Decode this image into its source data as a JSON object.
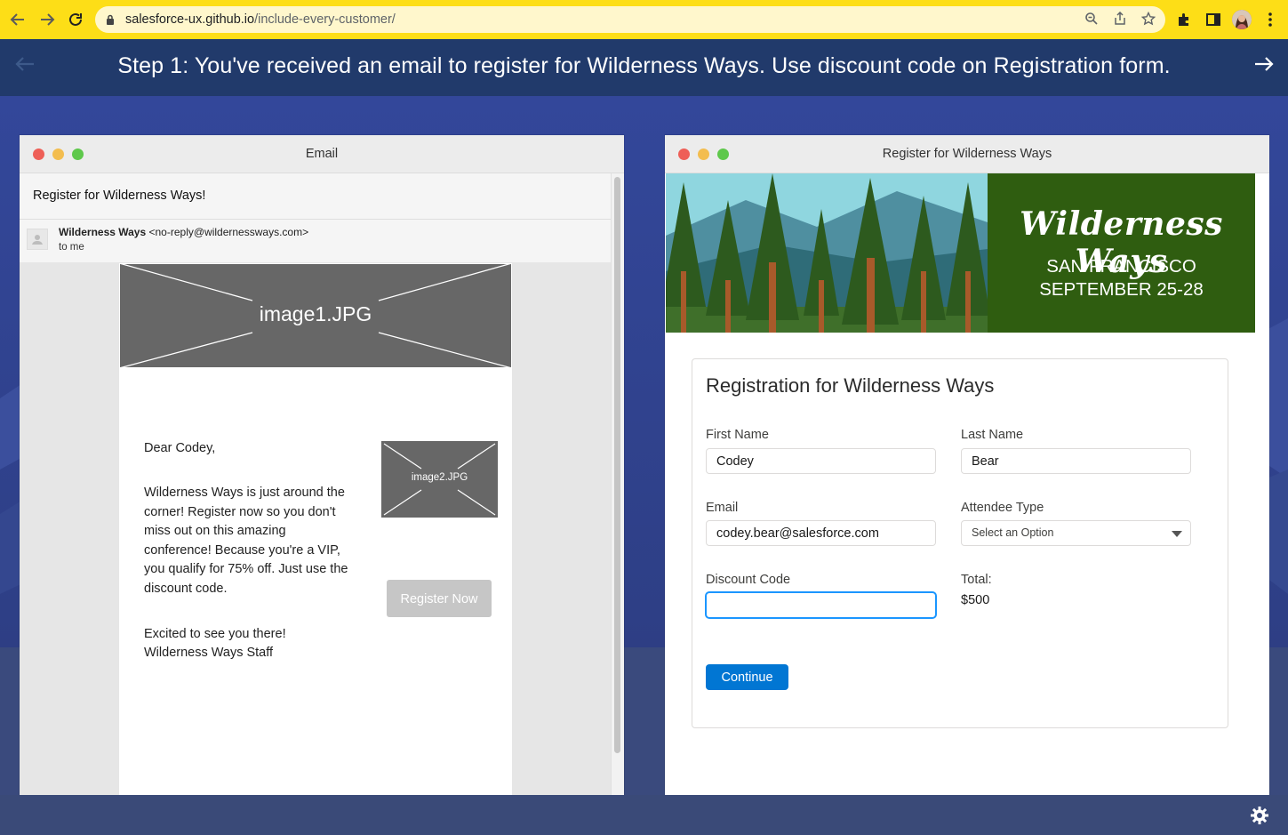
{
  "browser": {
    "url_host": "salesforce-ux.github.io",
    "url_path": "/include-every-customer/"
  },
  "step": {
    "text": "Step 1: You've received an email to register for Wilderness Ways. Use discount code on Registration form."
  },
  "email_window": {
    "title": "Email",
    "subject": "Register for Wilderness Ways!",
    "sender_name": "Wilderness Ways",
    "sender_email": "<no-reply@wildernessways.com>",
    "to": "to me",
    "image1": "image1.JPG",
    "image2": "image2.JPG",
    "greeting": "Dear Codey,",
    "body": "Wilderness Ways is just around the corner! Register now so you don't miss out on this amazing conference! Because you're a VIP, you qualify for 75% off. Just use the discount code.",
    "signoff_1": "Excited to see you there!",
    "signoff_2": "Wilderness Ways Staff",
    "register_button": "Register Now"
  },
  "registration_window": {
    "title": "Register for Wilderness Ways",
    "banner": {
      "brand": "Wilderness Ways",
      "city": "SAN FRANCISCO",
      "dates": "SEPTEMBER 25-28"
    },
    "form": {
      "title": "Registration for Wilderness Ways",
      "first_name_label": "First Name",
      "first_name_value": "Codey",
      "last_name_label": "Last Name",
      "last_name_value": "Bear",
      "email_label": "Email",
      "email_value": "codey.bear@salesforce.com",
      "attendee_label": "Attendee Type",
      "attendee_value": "Select an Option",
      "discount_label": "Discount Code",
      "discount_value": "",
      "total_label": "Total:",
      "total_value": "$500",
      "continue_button": "Continue"
    }
  },
  "colors": {
    "browser_bar": "#fdde17",
    "step_bar": "#213a6b",
    "primary_button": "#0176d3",
    "banner_green": "#2f5d10"
  }
}
